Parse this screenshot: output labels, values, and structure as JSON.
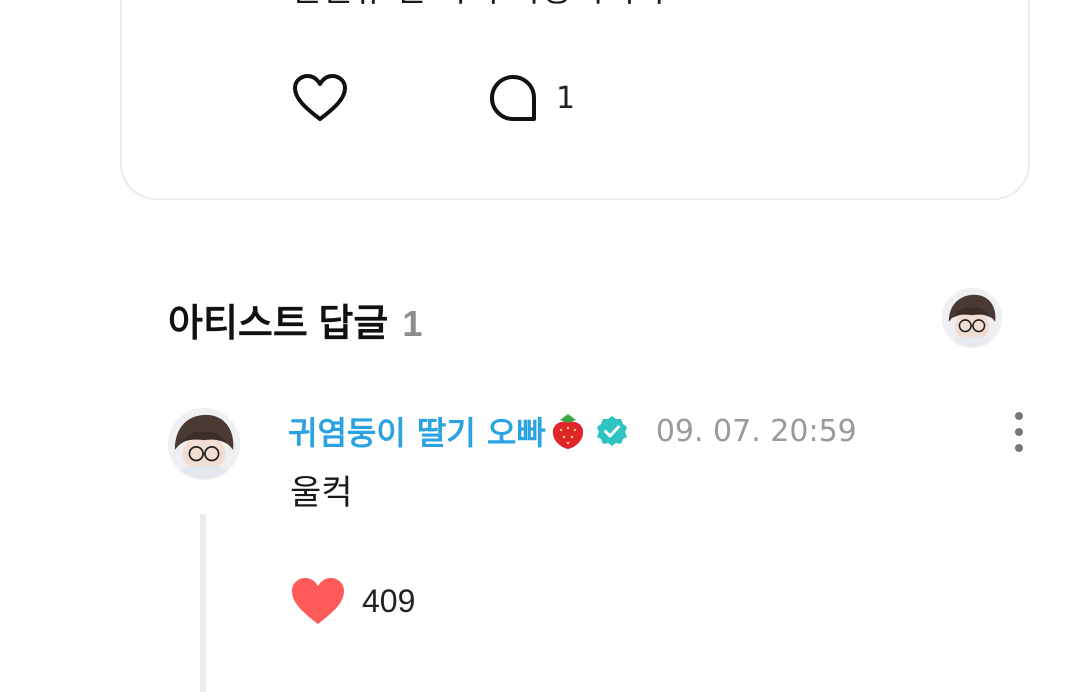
{
  "post": {
    "text": "신신유 넌 나의 자랑이니라",
    "comment_count": "1",
    "icons": {
      "like": "heart-outline-icon",
      "comment": "speech-bubble-icon"
    }
  },
  "artist_replies": {
    "title": "아티스트 답글",
    "count": "1"
  },
  "comment": {
    "author": "귀염둥이 딸기 오빠",
    "author_emoji": "strawberry-icon",
    "verified": "verified-badge-icon",
    "timestamp": "09. 07. 20:59",
    "text": "울컥",
    "likes": "409",
    "liked": true
  },
  "colors": {
    "author_name": "#2aa3e0",
    "verified_badge": "#2ec4c4",
    "liked_heart": "#ff5a5a",
    "muted_text": "#9a9a9a",
    "border": "#ececec"
  }
}
